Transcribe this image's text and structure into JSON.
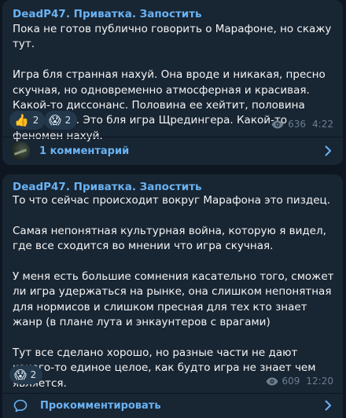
{
  "posts": [
    {
      "channel": "DeadP47. Приватка. Запостить",
      "paragraphs": [
        "Пока не готов публично говорить о Марафоне, но скажу тут.",
        "Игра бля странная нахуй. Она вроде и никакая, пресно скучная, но одновременно атмосферная и красивая. Какой-то диссонанс. Половина ее хейтит, половина восхваляет. Это бля игра Щредингера. Какой-то феномен нахуй."
      ],
      "reactions": [
        {
          "emoji": "👍",
          "count": "2"
        },
        {
          "emoji": "😱",
          "count": "2"
        }
      ],
      "views": "636",
      "time": "4:22",
      "comments_label": "1 комментарий"
    },
    {
      "channel": "DeadP47. Приватка. Запостить",
      "paragraphs": [
        "То что сейчас происходит вокруг Марафона это пиздец.",
        "Самая непонятная культурная война, которую я видел, где все сходится во мнении что игра скучная.",
        "У меня есть большие сомнения касательно того, сможет ли игра удержаться на рынке, она слишком непонятная для нормисов и слишком пресная для тех кто знает жанр (в плане лута и энкаунтеров с врагами)",
        "Тут все сделано хорошо, но разные части не дают какого-то единое целое, как будто игра не знает чем является."
      ],
      "reactions": [
        {
          "emoji": "😱",
          "count": "2"
        }
      ],
      "views": "609",
      "time": "12:20",
      "comments_label": "Прокомментировать"
    }
  ]
}
